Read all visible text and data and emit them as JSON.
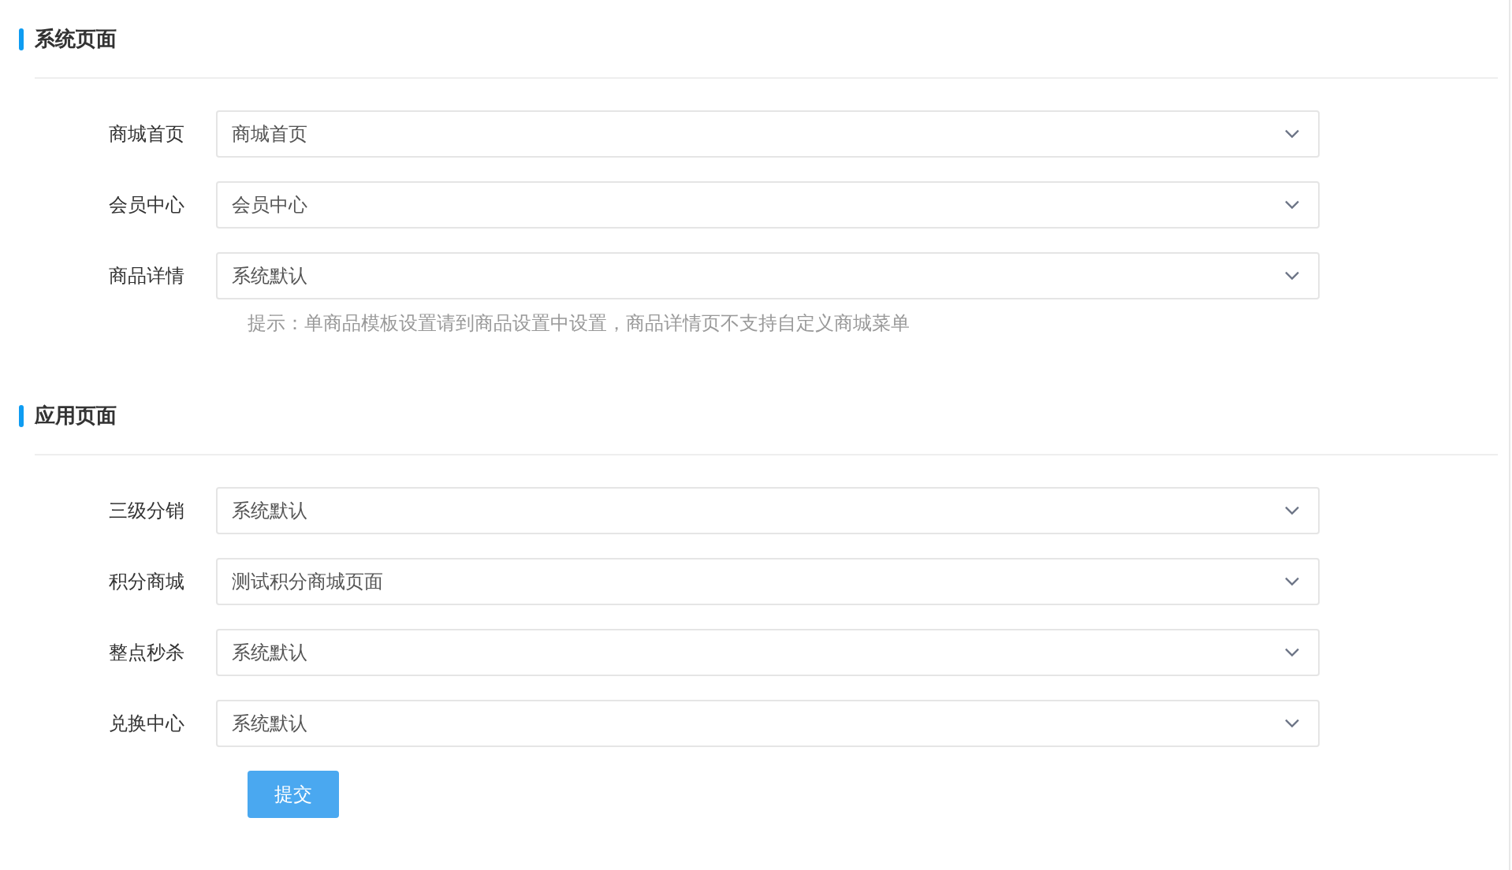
{
  "sections": [
    {
      "title": "系统页面",
      "rows": [
        {
          "label": "商城首页",
          "value": "商城首页"
        },
        {
          "label": "会员中心",
          "value": "会员中心"
        },
        {
          "label": "商品详情",
          "value": "系统默认",
          "hint": "提示：单商品模板设置请到商品设置中设置，商品详情页不支持自定义商城菜单"
        }
      ]
    },
    {
      "title": "应用页面",
      "rows": [
        {
          "label": "三级分销",
          "value": "系统默认"
        },
        {
          "label": "积分商城",
          "value": "测试积分商城页面"
        },
        {
          "label": "整点秒杀",
          "value": "系统默认"
        },
        {
          "label": "兑换中心",
          "value": "系统默认"
        }
      ]
    }
  ],
  "submit_button": "提交"
}
